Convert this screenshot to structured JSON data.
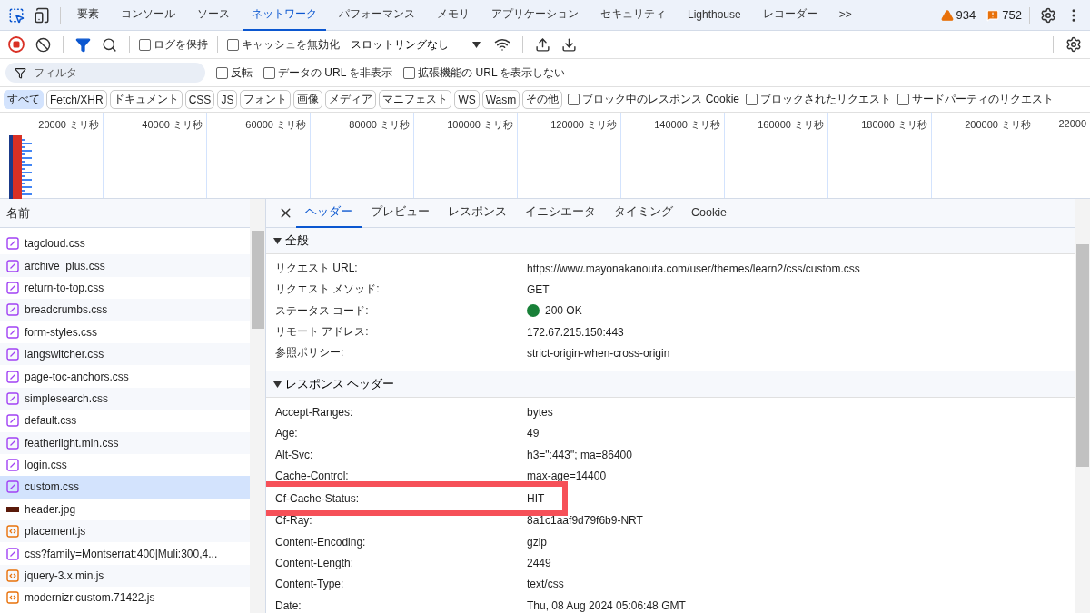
{
  "main_tabs": [
    {
      "label": "要素",
      "selected": false
    },
    {
      "label": "コンソール",
      "selected": false
    },
    {
      "label": "ソース",
      "selected": false
    },
    {
      "label": "ネットワーク",
      "selected": true
    },
    {
      "label": "パフォーマンス",
      "selected": false
    },
    {
      "label": "メモリ",
      "selected": false
    },
    {
      "label": "アプリケーション",
      "selected": false
    },
    {
      "label": "セキュリティ",
      "selected": false
    },
    {
      "label": "Lighthouse",
      "selected": false
    },
    {
      "label": "レコーダー",
      "selected": false
    }
  ],
  "more_tabs": ">>",
  "warnings": "934",
  "errors": "752",
  "toolbar": {
    "recording": true,
    "filter_on": true,
    "preserve_log": {
      "label": "ログを保持",
      "checked": false
    },
    "disable_cache": {
      "label": "キャッシュを無効化",
      "checked": false
    },
    "throttling": "スロットリングなし"
  },
  "filter": {
    "placeholder": "フィルタ",
    "options": [
      {
        "label": "反転",
        "checked": false
      },
      {
        "label": "データの URL を非表示",
        "checked": false
      },
      {
        "label": "拡張機能の URL を表示しない",
        "checked": false
      }
    ]
  },
  "type_filters": [
    {
      "label": "すべて",
      "selected": true
    },
    {
      "label": "Fetch/XHR",
      "selected": false
    },
    {
      "label": "ドキュメント",
      "selected": false
    },
    {
      "label": "CSS",
      "selected": false
    },
    {
      "label": "JS",
      "selected": false
    },
    {
      "label": "フォント",
      "selected": false
    },
    {
      "label": "画像",
      "selected": false
    },
    {
      "label": "メディア",
      "selected": false
    },
    {
      "label": "マニフェスト",
      "selected": false
    },
    {
      "label": "WS",
      "selected": false
    },
    {
      "label": "Wasm",
      "selected": false
    },
    {
      "label": "その他",
      "selected": false
    }
  ],
  "type_options": [
    {
      "label": "ブロック中のレスポンス Cookie",
      "checked": false
    },
    {
      "label": "ブロックされたリクエスト",
      "checked": false
    },
    {
      "label": "サードパーティのリクエスト",
      "checked": false
    }
  ],
  "overview_ticks": [
    "20000 ミリ秒",
    "40000 ミリ秒",
    "60000 ミリ秒",
    "80000 ミリ秒",
    "100000 ミリ秒",
    "120000 ミリ秒",
    "140000 ミリ秒",
    "160000 ミリ秒",
    "180000 ミリ秒",
    "200000 ミリ秒",
    "22000"
  ],
  "requests": {
    "column": "名前",
    "rows": [
      {
        "name": "tagcloud.css",
        "kind": "css",
        "selected": false
      },
      {
        "name": "archive_plus.css",
        "kind": "css",
        "selected": false
      },
      {
        "name": "return-to-top.css",
        "kind": "css",
        "selected": false
      },
      {
        "name": "breadcrumbs.css",
        "kind": "css",
        "selected": false
      },
      {
        "name": "form-styles.css",
        "kind": "css",
        "selected": false
      },
      {
        "name": "langswitcher.css",
        "kind": "css",
        "selected": false
      },
      {
        "name": "page-toc-anchors.css",
        "kind": "css",
        "selected": false
      },
      {
        "name": "simplesearch.css",
        "kind": "css",
        "selected": false
      },
      {
        "name": "default.css",
        "kind": "css",
        "selected": false
      },
      {
        "name": "featherlight.min.css",
        "kind": "css",
        "selected": false
      },
      {
        "name": "login.css",
        "kind": "css",
        "selected": false
      },
      {
        "name": "custom.css",
        "kind": "css",
        "selected": true
      },
      {
        "name": "header.jpg",
        "kind": "image",
        "selected": false
      },
      {
        "name": "placement.js",
        "kind": "js",
        "selected": false
      },
      {
        "name": "css?family=Montserrat:400|Muli:300,4...",
        "kind": "css",
        "selected": false
      },
      {
        "name": "jquery-3.x.min.js",
        "kind": "js",
        "selected": false
      },
      {
        "name": "modernizr.custom.71422.js",
        "kind": "js",
        "selected": false
      }
    ]
  },
  "detail_tabs": [
    {
      "label": "ヘッダー",
      "selected": true
    },
    {
      "label": "プレビュー",
      "selected": false
    },
    {
      "label": "レスポンス",
      "selected": false
    },
    {
      "label": "イニシエータ",
      "selected": false
    },
    {
      "label": "タイミング",
      "selected": false
    },
    {
      "label": "Cookie",
      "selected": false
    }
  ],
  "sections": [
    {
      "title": "全般",
      "expanded": true,
      "rows": [
        {
          "name": "リクエスト URL:",
          "value": "https://www.mayonakanouta.com/user/themes/learn2/css/custom.css",
          "highlighted": false
        },
        {
          "name": "リクエスト メソッド:",
          "value": "GET",
          "highlighted": false
        },
        {
          "name": "ステータス コード:",
          "value": "200 OK",
          "color": "#188038",
          "highlighted": false
        },
        {
          "name": "リモート アドレス:",
          "value": "172.67.215.150:443",
          "highlighted": false
        },
        {
          "name": "参照ポリシー:",
          "value": "strict-origin-when-cross-origin",
          "highlighted": false
        }
      ]
    },
    {
      "title": "レスポンス ヘッダー",
      "expanded": true,
      "rows": [
        {
          "name": "Accept-Ranges:",
          "value": "bytes",
          "highlighted": false
        },
        {
          "name": "Age:",
          "value": "49",
          "highlighted": false
        },
        {
          "name": "Alt-Svc:",
          "value": "h3=\":443\"; ma=86400",
          "highlighted": false
        },
        {
          "name": "Cache-Control:",
          "value": "max-age=14400",
          "highlighted": false
        },
        {
          "name": "Cf-Cache-Status:",
          "value": "HIT",
          "highlighted": true
        },
        {
          "name": "Cf-Ray:",
          "value": "8a1c1aaf9d79f6b9-NRT",
          "highlighted": false
        },
        {
          "name": "Content-Encoding:",
          "value": "gzip",
          "highlighted": false
        },
        {
          "name": "Content-Length:",
          "value": "2449",
          "highlighted": false
        },
        {
          "name": "Content-Type:",
          "value": "text/css",
          "highlighted": false
        },
        {
          "name": "Date:",
          "value": "Thu, 08 Aug 2024 05:06:48 GMT",
          "highlighted": false
        }
      ]
    }
  ]
}
